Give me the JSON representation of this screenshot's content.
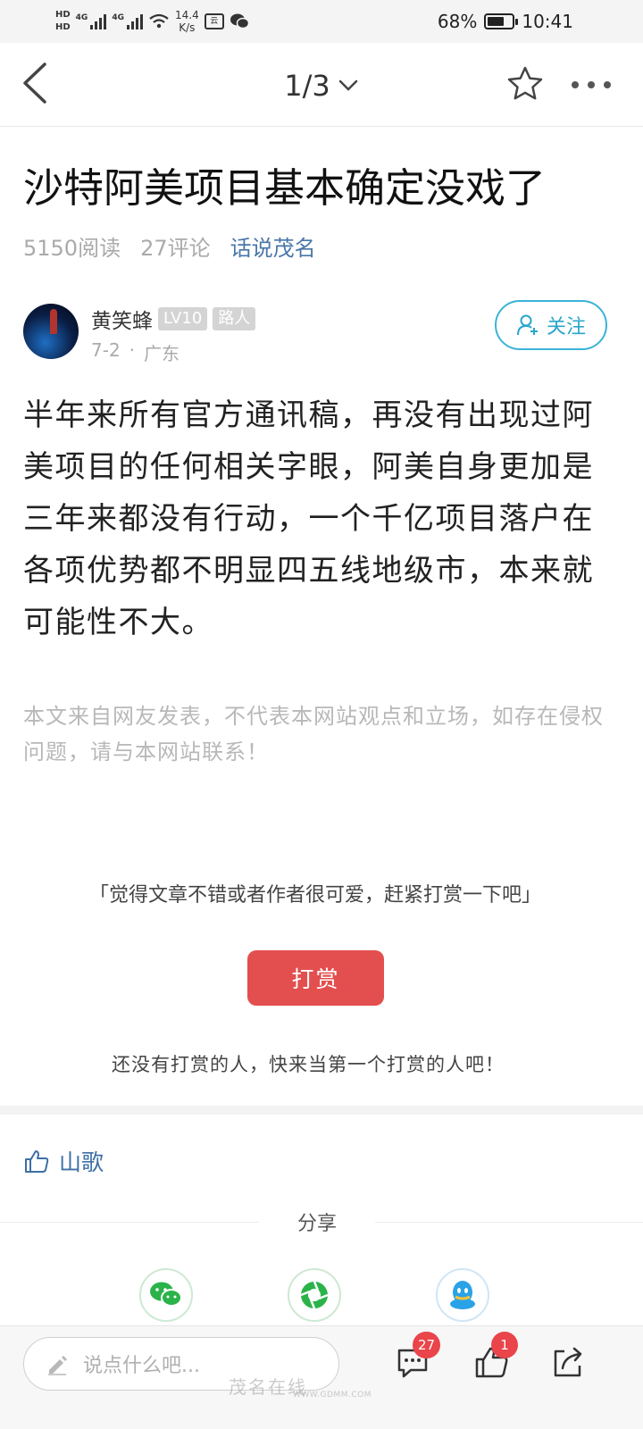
{
  "status_bar": {
    "network_speed": "14.4",
    "network_speed_unit": "K/s",
    "battery": "68%",
    "battery_level": 0.68,
    "time": "10:41"
  },
  "nav": {
    "page_indicator": "1/3"
  },
  "post": {
    "title": "沙特阿美项目基本确定没戏了",
    "reads": "5150阅读",
    "comments": "27评论",
    "topic": "话说茂名"
  },
  "author": {
    "name": "黄笑蜂",
    "level": "LV10",
    "rank": "路人",
    "date": "7-2",
    "separator": "·",
    "location": "广东",
    "follow_label": "关注"
  },
  "content": {
    "body": "半年来所有官方通讯稿，再没有出现过阿美项目的任何相关字眼，阿美自身更加是三年来都没有行动，一个千亿项目落户在各项优势都不明显四五线地级市，本来就可能性不大。",
    "disclaimer": "本文来自网友发表，不代表本网站观点和立场，如存在侵权问题，请与本网站联系！"
  },
  "reward": {
    "prompt": "「觉得文章不错或者作者很可爱，赶紧打赏一下吧」",
    "button_label": "打赏",
    "empty_text": "还没有打赏的人，快来当第一个打赏的人吧！"
  },
  "likes": {
    "user": "山歌"
  },
  "share": {
    "label": "分享",
    "targets": [
      "wechat-icon",
      "moments-icon",
      "qq-icon"
    ]
  },
  "bottom_bar": {
    "comment_placeholder": "说点什么吧...",
    "comment_count": "27",
    "like_count": "1"
  },
  "watermark": {
    "text": "茂名在线",
    "url": "WWW.GDMM.COM"
  },
  "colors": {
    "accent_blue": "#3bb3d8",
    "topic_blue": "#4a76a8",
    "reward_red": "#e34f4f",
    "badge_red": "#e9454b",
    "wechat_green": "#2bb34a"
  }
}
